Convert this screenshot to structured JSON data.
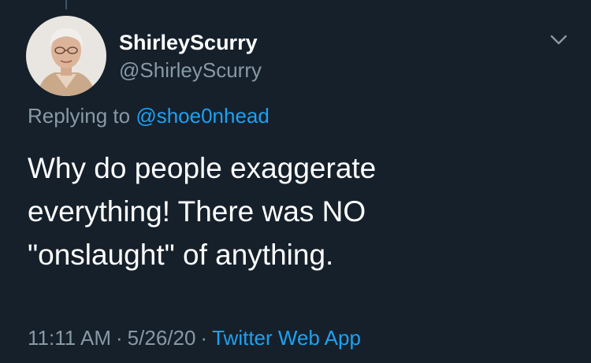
{
  "tweet": {
    "display_name": "ShirleyScurry",
    "handle": "@ShirleyScurry",
    "replying_prefix": "Replying to",
    "replying_to": "@shoe0nhead",
    "text_lines": [
      "Why do people exaggerate",
      "everything!  There was NO",
      "\"onslaught\"  of anything."
    ],
    "time": "11:11 AM",
    "separator": "·",
    "date": "5/26/20",
    "source": "Twitter Web App"
  },
  "icons": {
    "menu": "chevron-down-icon"
  },
  "colors": {
    "background": "#15202b",
    "primary_text": "#ffffff",
    "secondary_text": "#8899a6",
    "accent": "#1da1f2"
  }
}
